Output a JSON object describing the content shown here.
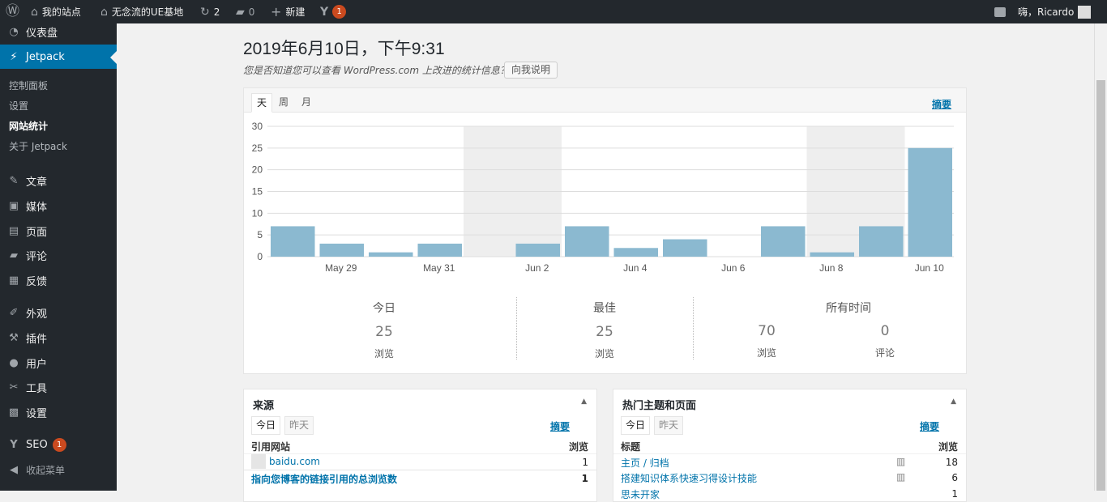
{
  "adminbar": {
    "wp_icon": "wordpress-logo-icon",
    "site_name": "我的站点",
    "site2_name": "无念流的UE基地",
    "updates_count": "2",
    "comments_count": "0",
    "new_label": "新建",
    "yoast_badge": "1",
    "greeting": "嗨，Ricardo"
  },
  "sidebar": {
    "dashboard": "仪表盘",
    "jetpack": "Jetpack",
    "jetpack_sub": [
      "控制面板",
      "设置",
      "网站统计",
      "关于 Jetpack"
    ],
    "posts": "文章",
    "media": "媒体",
    "pages": "页面",
    "comments": "评论",
    "feedback": "反馈",
    "appearance": "外观",
    "plugins": "插件",
    "users": "用户",
    "tools": "工具",
    "settings": "设置",
    "seo": "SEO",
    "seo_badge": "1",
    "collapse": "收起菜单"
  },
  "main": {
    "date_title": "2019年6月10日，下午9:31",
    "notice": "您是否知道您可以查看 WordPress.com 上改进的统计信息？",
    "explain_button": "向我说明"
  },
  "stats": {
    "tabs": [
      "天",
      "周",
      "月"
    ],
    "summary_link": "摘要",
    "today_label": "今日",
    "today_value": "25",
    "best_label": "最佳",
    "best_value": "25",
    "alltime_label": "所有时间",
    "alltime_views": "70",
    "alltime_comments": "0",
    "views_unit": "浏览",
    "comments_unit": "评论"
  },
  "chart_data": {
    "type": "bar",
    "categories": [
      "May 28",
      "May 29",
      "May 30",
      "May 31",
      "Jun 1",
      "Jun 2",
      "Jun 3",
      "Jun 4",
      "Jun 5",
      "Jun 6",
      "Jun 7",
      "Jun 8",
      "Jun 9",
      "Jun 10"
    ],
    "tick_labels": [
      "May 29",
      "May 31",
      "Jun 2",
      "Jun 4",
      "Jun 6",
      "Jun 8",
      "Jun 10"
    ],
    "values": [
      7,
      3,
      1,
      3,
      0,
      3,
      7,
      2,
      4,
      0,
      7,
      1,
      7,
      25
    ],
    "weekend_indices": [
      4,
      11
    ],
    "ylim": [
      0,
      30
    ],
    "yticks": [
      0,
      5,
      10,
      15,
      20,
      25,
      30
    ],
    "grid": true,
    "bar_color": "#8bb9d0",
    "weekend_color": "#eeeeee"
  },
  "referrers": {
    "title": "来源",
    "tabs": [
      "今日",
      "昨天"
    ],
    "summary_link": "摘要",
    "col_site": "引用网站",
    "col_views": "浏览",
    "rows": [
      {
        "name": "baidu.com",
        "views": "1"
      },
      {
        "name": "指向您博客的链接引用的总浏览数",
        "views": "1"
      }
    ]
  },
  "top_posts": {
    "title": "热门主题和页面",
    "tabs": [
      "今日",
      "昨天"
    ],
    "summary_link": "摘要",
    "col_title": "标题",
    "col_views": "浏览",
    "rows": [
      {
        "name": "主页 / 归档",
        "views": "18"
      },
      {
        "name": "搭建知识体系快速习得设计技能",
        "views": "6"
      },
      {
        "name": "思未开家",
        "views": "1"
      }
    ]
  }
}
